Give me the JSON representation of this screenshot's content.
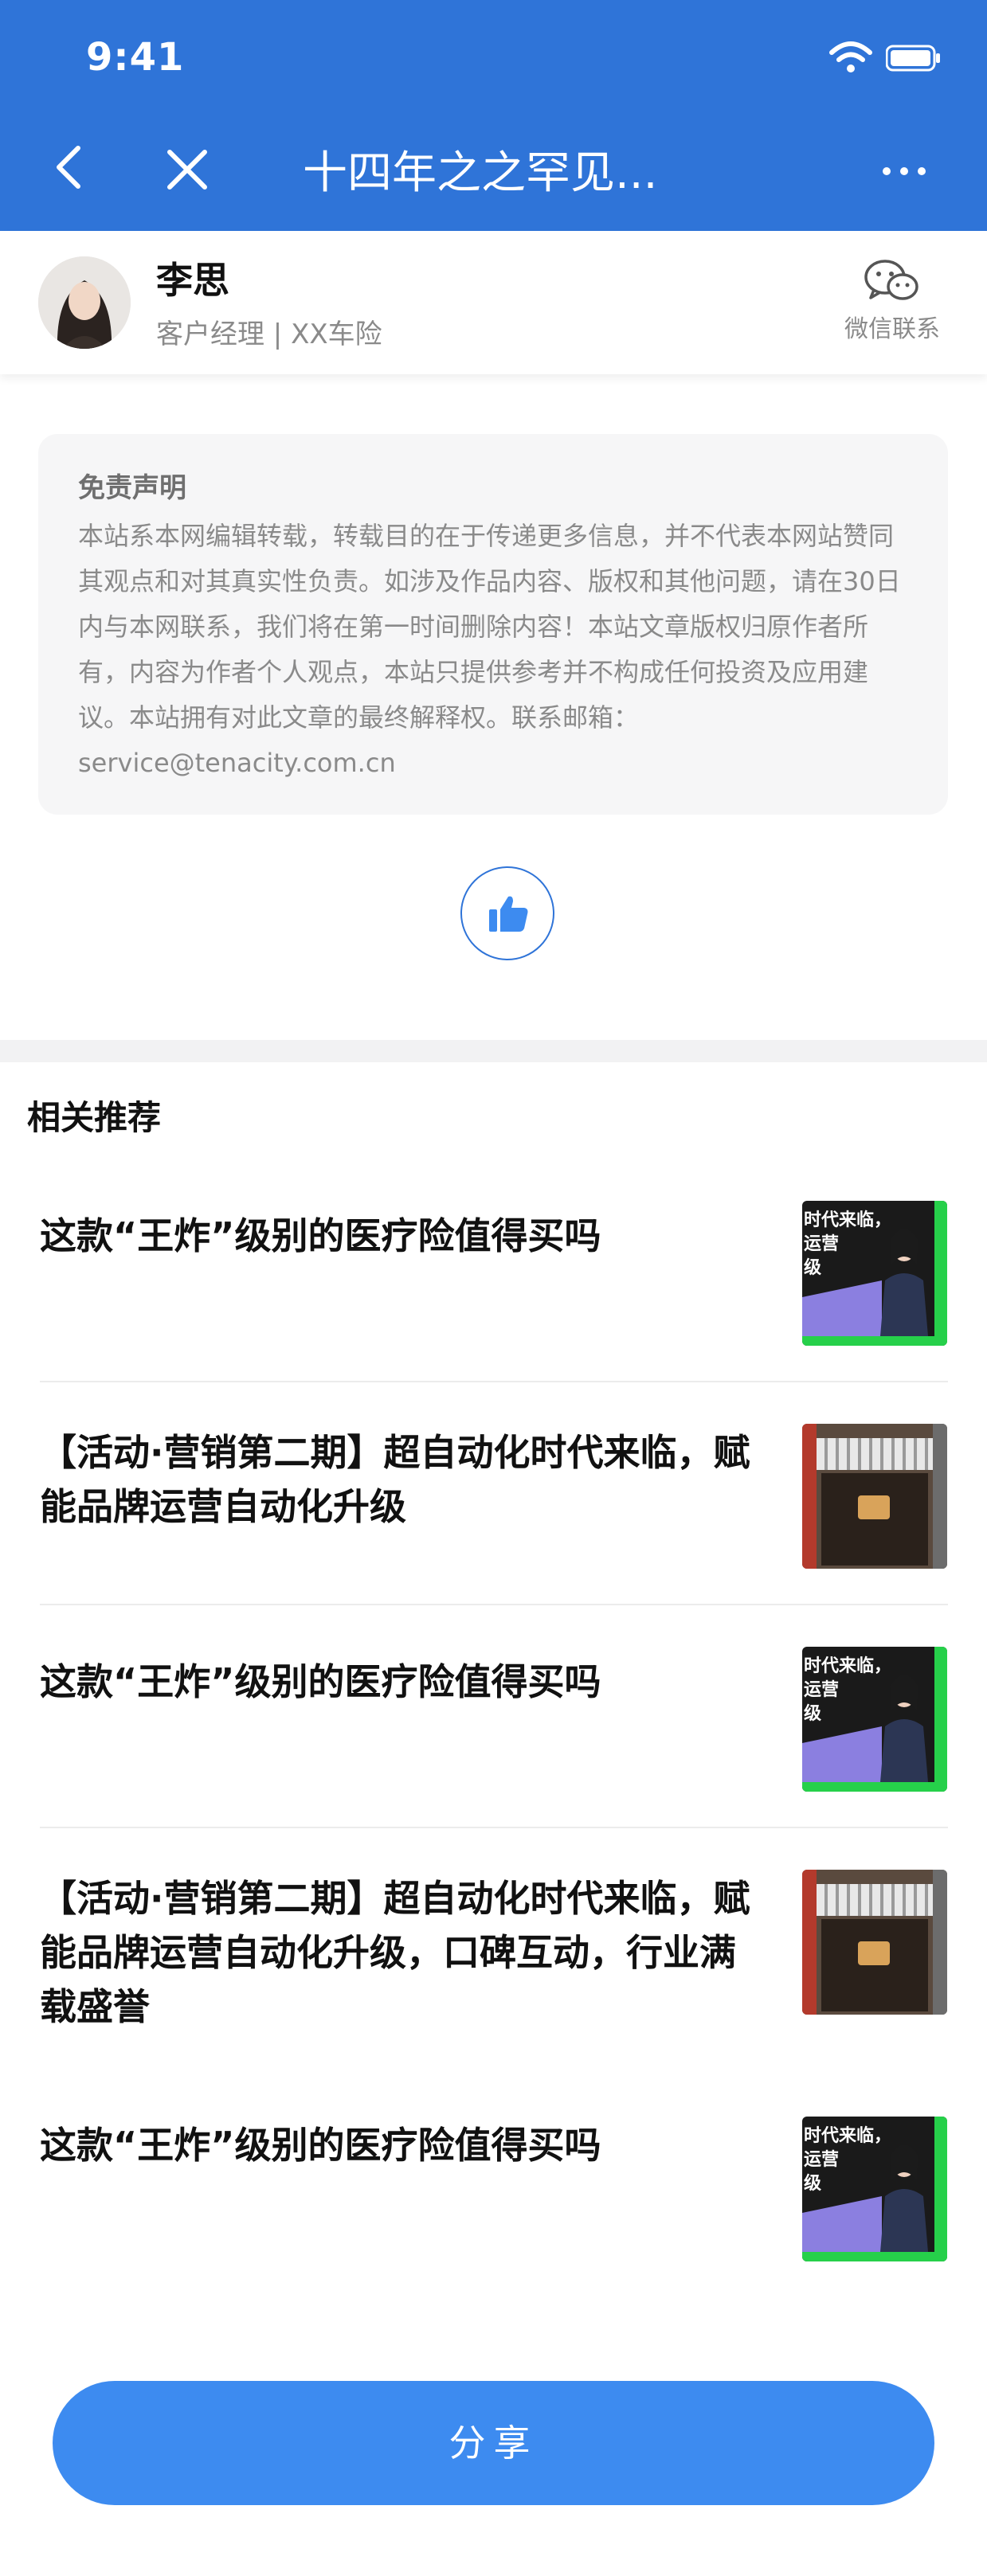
{
  "status_bar": {
    "time": "9:41"
  },
  "nav": {
    "title": "十四年之之罕见..."
  },
  "agent": {
    "name": "李思",
    "subtitle": "客户经理 | XX车险",
    "wechat_label": "微信联系"
  },
  "disclaimer": {
    "title": "免责声明",
    "body": "本站系本网编辑转载，转载目的在于传递更多信息，并不代表本网站赞同其观点和对其真实性负责。如涉及作品内容、版权和其他问题，请在30日内与本网联系，我们将在第一时间删除内容！本站文章版权归原作者所有，内容为作者个人观点，本站只提供参考并不构成任何投资及应用建议。本站拥有对此文章的最终解释权。联系邮箱：service@tenacity.com.cn"
  },
  "recommend": {
    "title": "相关推荐",
    "items": [
      {
        "title": "这款“王炸”级别的医疗险值得买吗",
        "thumb": "promo"
      },
      {
        "title": "【活动·营销第二期】超自动化时代来临，赋能品牌运营自动化升级",
        "thumb": "shop"
      },
      {
        "title": "这款“王炸”级别的医疗险值得买吗",
        "thumb": "promo"
      },
      {
        "title": "【活动·营销第二期】超自动化时代来临，赋能品牌运营自动化升级，口碑互动，行业满载盛誉",
        "thumb": "shop"
      },
      {
        "title": "这款“王炸”级别的医疗险值得买吗",
        "thumb": "promo"
      }
    ],
    "thumb_promo_text": "时代来临，\n运营\n级"
  },
  "share": {
    "label": "分享"
  },
  "colors": {
    "primary": "#2f74d8",
    "share_button": "#3d8bf0",
    "accent_green": "#26d04a"
  }
}
